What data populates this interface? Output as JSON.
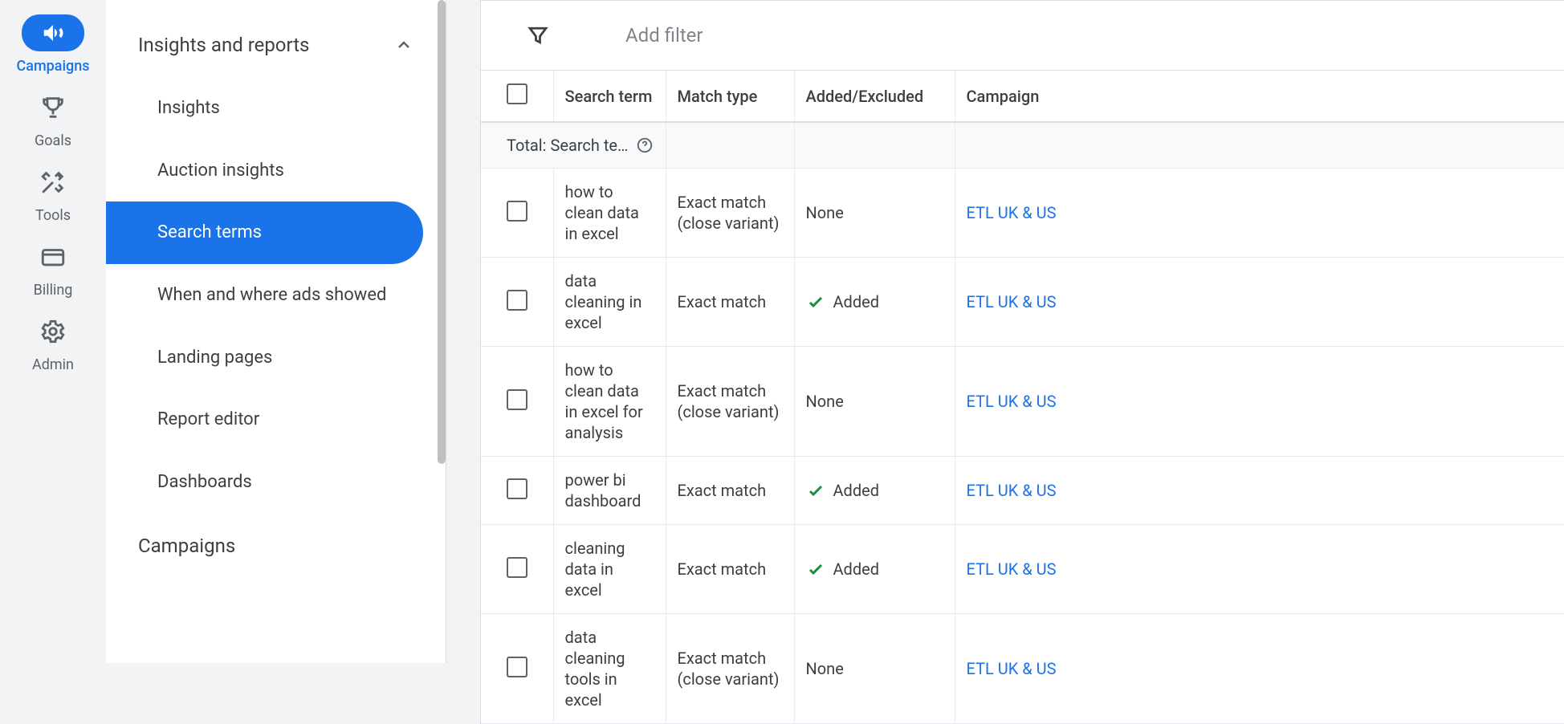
{
  "iconRail": [
    {
      "name": "campaigns",
      "label": "Campaigns",
      "active": true
    },
    {
      "name": "goals",
      "label": "Goals",
      "active": false
    },
    {
      "name": "tools",
      "label": "Tools",
      "active": false
    },
    {
      "name": "billing",
      "label": "Billing",
      "active": false
    },
    {
      "name": "admin",
      "label": "Admin",
      "active": false
    }
  ],
  "sidebar": {
    "sectionTitle": "Insights and reports",
    "items": [
      {
        "label": "Insights",
        "active": false
      },
      {
        "label": "Auction insights",
        "active": false
      },
      {
        "label": "Search terms",
        "active": true
      },
      {
        "label": "When and where ads showed",
        "active": false
      },
      {
        "label": "Landing pages",
        "active": false
      },
      {
        "label": "Report editor",
        "active": false
      },
      {
        "label": "Dashboards",
        "active": false
      }
    ],
    "nextSectionTitle": "Campaigns"
  },
  "filter": {
    "placeholder": "Add filter"
  },
  "table": {
    "headers": {
      "searchTerm": "Search term",
      "matchType": "Match type",
      "addedExcluded": "Added/Excluded",
      "campaign": "Campaign"
    },
    "totalLabel": "Total: Search te…",
    "rows": [
      {
        "term": "how to clean data in excel",
        "match": "Exact match (close variant)",
        "status": "None",
        "added": false,
        "campaign": "ETL UK & US"
      },
      {
        "term": "data cleaning in excel",
        "match": "Exact match",
        "status": "Added",
        "added": true,
        "campaign": "ETL UK & US"
      },
      {
        "term": "how to clean data in excel for analysis",
        "match": "Exact match (close variant)",
        "status": "None",
        "added": false,
        "campaign": "ETL UK & US"
      },
      {
        "term": "power bi dashboard",
        "match": "Exact match",
        "status": "Added",
        "added": true,
        "campaign": "ETL UK & US"
      },
      {
        "term": "cleaning data in excel",
        "match": "Exact match",
        "status": "Added",
        "added": true,
        "campaign": "ETL UK & US"
      },
      {
        "term": "data cleaning tools in excel",
        "match": "Exact match (close variant)",
        "status": "None",
        "added": false,
        "campaign": "ETL UK & US"
      }
    ]
  }
}
